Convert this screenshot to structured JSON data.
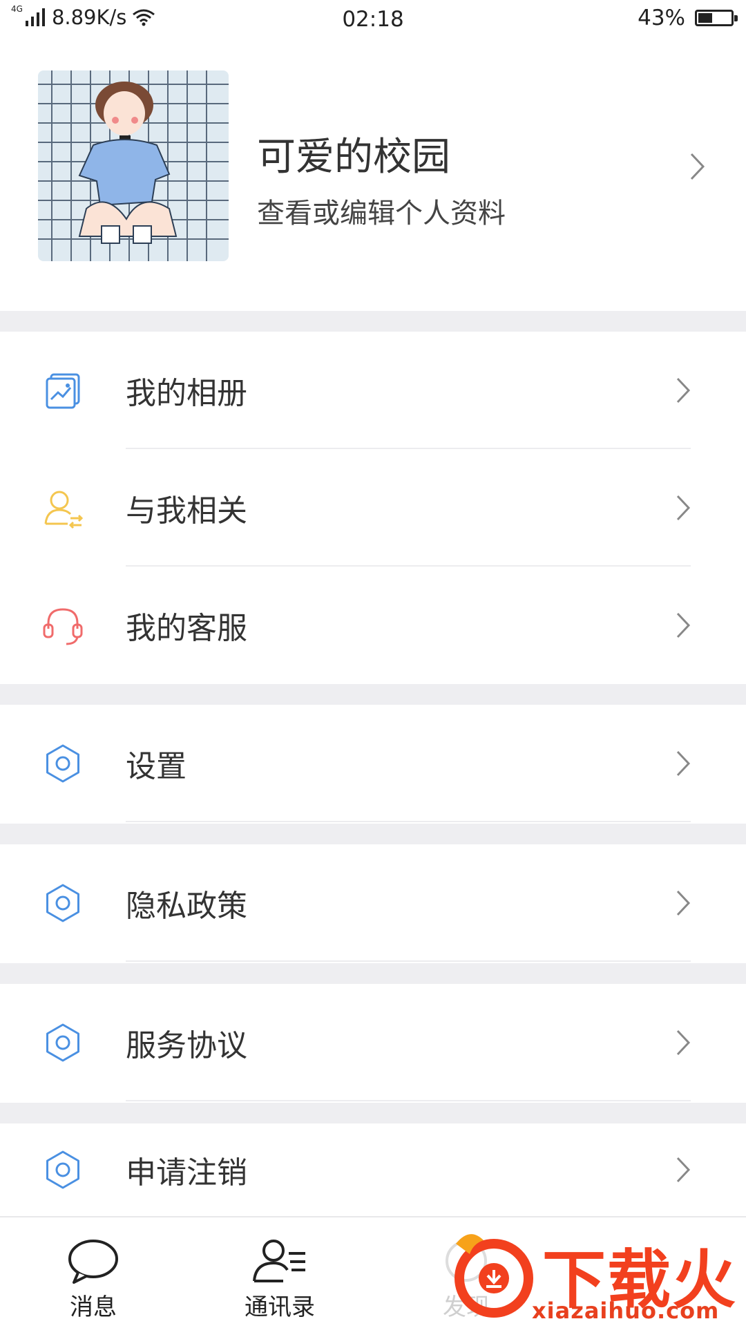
{
  "status_bar": {
    "network": "4G",
    "speed": "8.89K/s",
    "time": "02:18",
    "battery": "43%",
    "battery_level": 0.43
  },
  "profile": {
    "name": "可爱的校园",
    "subtitle": "查看或编辑个人资料"
  },
  "menu": [
    {
      "label": "我的相册",
      "icon": "album-icon",
      "color": "#4a90e2"
    },
    {
      "label": "与我相关",
      "icon": "user-related-icon",
      "color": "#f4c64f"
    },
    {
      "label": "我的客服",
      "icon": "headset-icon",
      "color": "#f06b6b"
    },
    {
      "label": "设置",
      "icon": "gear-icon",
      "color": "#4a90e2"
    },
    {
      "label": "隐私政策",
      "icon": "gear-icon",
      "color": "#4a90e2"
    },
    {
      "label": "服务协议",
      "icon": "gear-icon",
      "color": "#4a90e2"
    },
    {
      "label": "申请注销",
      "icon": "gear-icon",
      "color": "#4a90e2"
    }
  ],
  "bottom_nav": [
    {
      "label": "消息",
      "icon": "chat-bubble-icon"
    },
    {
      "label": "通讯录",
      "icon": "contacts-icon"
    },
    {
      "label": "发现",
      "icon": "discover-icon"
    }
  ],
  "watermark": {
    "brand": "下载火",
    "url": "xiazaihuo.com"
  }
}
